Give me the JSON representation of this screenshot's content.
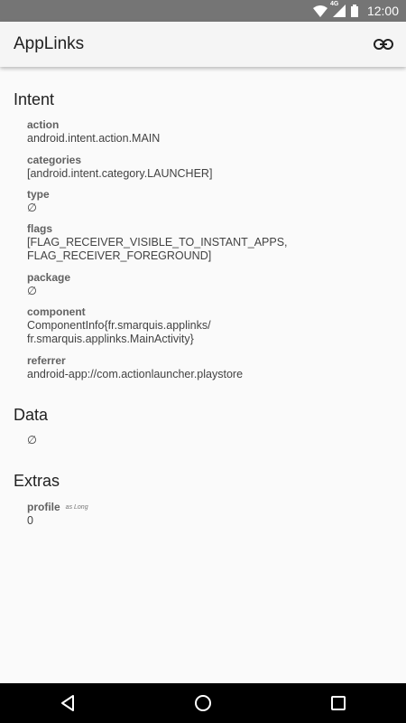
{
  "status_bar": {
    "time": "12:00",
    "network": "4G"
  },
  "app_bar": {
    "title": "AppLinks",
    "action_icon": "link-icon"
  },
  "intent": {
    "heading": "Intent",
    "fields": [
      {
        "label": "action",
        "value": "android.intent.action.MAIN"
      },
      {
        "label": "categories",
        "value": "[android.intent.category.LAUNCHER]"
      },
      {
        "label": "type",
        "value": "∅"
      },
      {
        "label": "flags",
        "value_lines": [
          "[FLAG_RECEIVER_VISIBLE_TO_INSTANT_APPS,",
          "FLAG_RECEIVER_FOREGROUND]"
        ]
      },
      {
        "label": "package",
        "value": "∅"
      },
      {
        "label": "component",
        "value_lines": [
          "ComponentInfo{fr.smarquis.applinks/",
          "fr.smarquis.applinks.MainActivity}"
        ]
      },
      {
        "label": "referrer",
        "value": "android-app://com.actionlauncher.playstore"
      }
    ]
  },
  "data": {
    "heading": "Data",
    "value": "∅"
  },
  "extras": {
    "heading": "Extras",
    "items": [
      {
        "label": "profile",
        "type_hint": "as Long",
        "value": "0"
      }
    ]
  },
  "nav_bar": {
    "icons": [
      "back-icon",
      "home-icon",
      "recents-icon"
    ]
  },
  "colors": {
    "status_bar": "#757575",
    "app_bar": "#f5f5f5",
    "background": "#fafafa",
    "nav_bar": "#000000"
  }
}
